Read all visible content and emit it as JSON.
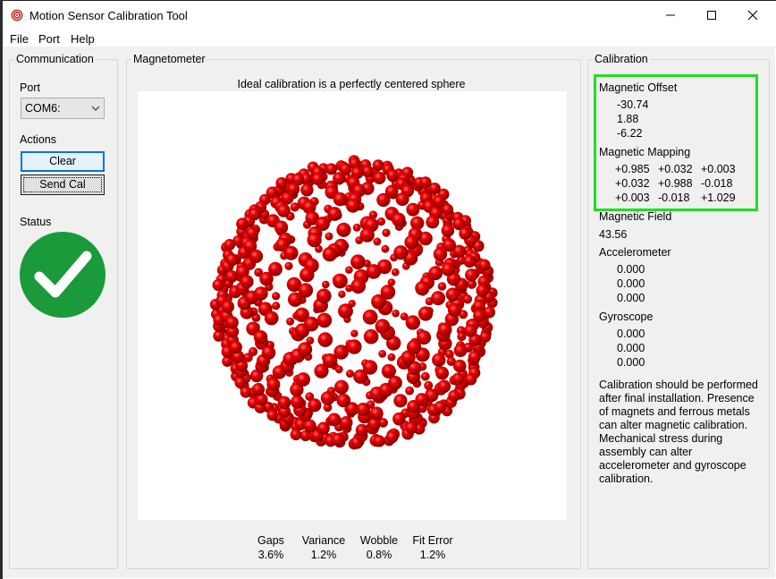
{
  "window": {
    "title": "Motion Sensor Calibration Tool",
    "minimize_glyph": "—",
    "maximize_glyph": "☐",
    "close_glyph": "✕"
  },
  "menu": {
    "file": "File",
    "port": "Port",
    "help": "Help"
  },
  "communication": {
    "group_label": "Communication",
    "port_label": "Port",
    "port_value": "COM6:",
    "actions_label": "Actions",
    "clear_button": "Clear",
    "send_cal_button": "Send Cal",
    "status_label": "Status",
    "status_icon": "checkmark-icon",
    "status_color": "#1a9a3a"
  },
  "magnetometer": {
    "group_label": "Magnetometer",
    "caption": "Ideal calibration is a perfectly centered sphere",
    "point_color": "#d40000",
    "stats": [
      {
        "label": "Gaps",
        "value": "3.6%"
      },
      {
        "label": "Variance",
        "value": "1.2%"
      },
      {
        "label": "Wobble",
        "value": "0.8%"
      },
      {
        "label": "Fit Error",
        "value": "1.2%"
      }
    ]
  },
  "calibration": {
    "group_label": "Calibration",
    "highlight_color": "#22dd22",
    "magnetic_offset_label": "Magnetic Offset",
    "magnetic_offset": [
      "-30.74",
      "1.88",
      "-6.22"
    ],
    "magnetic_mapping_label": "Magnetic Mapping",
    "magnetic_mapping": [
      [
        "+0.985",
        "+0.032",
        "+0.003"
      ],
      [
        "+0.032",
        "+0.988",
        "-0.018"
      ],
      [
        "+0.003",
        "-0.018",
        "+1.029"
      ]
    ],
    "magnetic_field_label": "Magnetic Field",
    "magnetic_field": "43.56",
    "accelerometer_label": "Accelerometer",
    "accelerometer": [
      "0.000",
      "0.000",
      "0.000"
    ],
    "gyroscope_label": "Gyroscope",
    "gyroscope": [
      "0.000",
      "0.000",
      "0.000"
    ],
    "note": "Calibration should be performed after final installation.  Presence of magnets and ferrous metals can alter magnetic calibration.  Mechanical stress during assembly can alter accelerometer and gyroscope calibration."
  }
}
